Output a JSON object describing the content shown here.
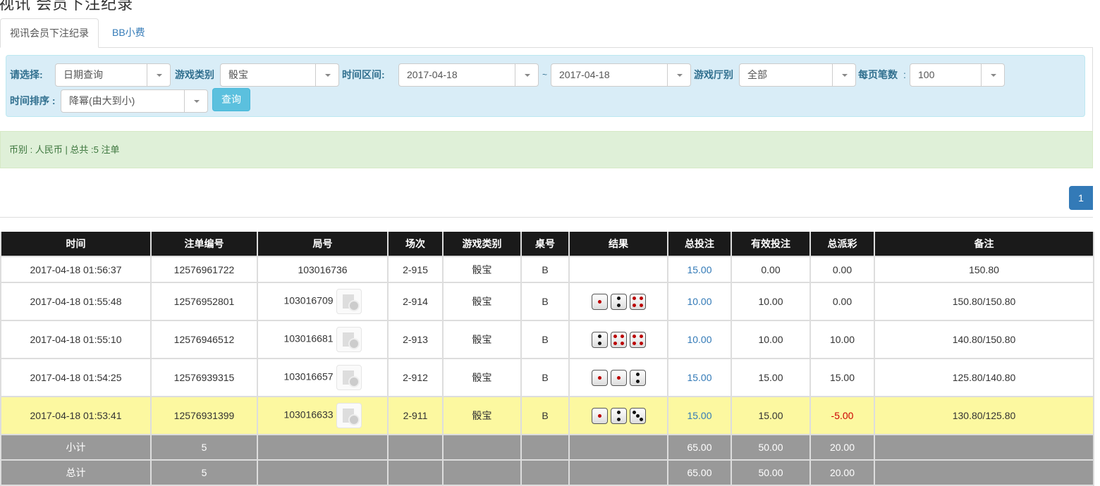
{
  "page_title": "视讯 会员下注纪录",
  "tabs": [
    {
      "label": "视讯会员下注纪录"
    },
    {
      "label": "BB小费"
    }
  ],
  "filters": {
    "select_label": "请选择:",
    "select_value": "日期查询",
    "game_type_label": "游戏类别",
    "game_type_value": "骰宝",
    "time_range_label": "时间区间:",
    "date_from": "2017-04-18",
    "tilde": "~",
    "date_to": "2017-04-18",
    "hall_label": "游戏厅别",
    "hall_value": "全部",
    "per_page_label": "每页笔数",
    "per_page_sep": ":",
    "per_page_value": "100",
    "sort_label": "时间排序 :",
    "sort_value": "降幂(由大到小)",
    "query_button": "查询"
  },
  "summary": "币别 : 人民币 | 总共 :5 注单",
  "pagination": {
    "current": "1"
  },
  "table": {
    "headers": [
      "时间",
      "注单编号",
      "局号",
      "场次",
      "游戏类别",
      "桌号",
      "结果",
      "总投注",
      "有效投注",
      "总派彩",
      "备注"
    ],
    "rows": [
      {
        "time": "2017-04-18 01:56:37",
        "bet_id": "12576961722",
        "round": "103016736",
        "video": false,
        "session": "2-915",
        "game": "骰宝",
        "table": "B",
        "dice": [],
        "total_bet": "15.00",
        "valid_bet": "0.00",
        "payout": "0.00",
        "note": "150.80",
        "highlight": false
      },
      {
        "time": "2017-04-18 01:55:48",
        "bet_id": "12576952801",
        "round": "103016709",
        "video": true,
        "session": "2-914",
        "game": "骰宝",
        "table": "B",
        "dice": [
          1,
          2,
          4
        ],
        "total_bet": "10.00",
        "valid_bet": "10.00",
        "payout": "0.00",
        "note": "150.80/150.80",
        "highlight": false
      },
      {
        "time": "2017-04-18 01:55:10",
        "bet_id": "12576946512",
        "round": "103016681",
        "video": true,
        "session": "2-913",
        "game": "骰宝",
        "table": "B",
        "dice": [
          2,
          4,
          4
        ],
        "total_bet": "10.00",
        "valid_bet": "10.00",
        "payout": "10.00",
        "note": "140.80/150.80",
        "highlight": false
      },
      {
        "time": "2017-04-18 01:54:25",
        "bet_id": "12576939315",
        "round": "103016657",
        "video": true,
        "session": "2-912",
        "game": "骰宝",
        "table": "B",
        "dice": [
          1,
          1,
          2
        ],
        "total_bet": "15.00",
        "valid_bet": "15.00",
        "payout": "15.00",
        "note": "125.80/140.80",
        "highlight": false
      },
      {
        "time": "2017-04-18 01:53:41",
        "bet_id": "12576931399",
        "round": "103016633",
        "video": true,
        "session": "2-911",
        "game": "骰宝",
        "table": "B",
        "dice": [
          1,
          2,
          3
        ],
        "total_bet": "15.00",
        "valid_bet": "15.00",
        "payout": "-5.00",
        "note": "130.80/125.80",
        "highlight": true
      }
    ],
    "subtotal": {
      "label": "小计",
      "count": "5",
      "total_bet": "65.00",
      "valid_bet": "50.00",
      "payout": "20.00"
    },
    "total": {
      "label": "总计",
      "count": "5",
      "total_bet": "65.00",
      "valid_bet": "50.00",
      "payout": "20.00"
    }
  },
  "colors": {
    "header_bg": "#1a1a1a",
    "highlight_row": "#fcf8a0",
    "sum_row": "#999999",
    "link": "#337ab7",
    "negative": "#cc0000"
  }
}
